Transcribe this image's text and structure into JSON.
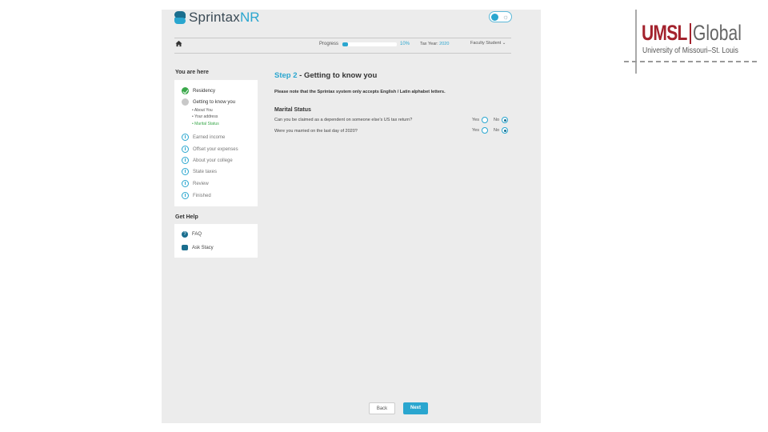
{
  "header": {
    "brand_main": "Sprintax",
    "brand_accent": "NR",
    "progress_label": "Progress",
    "progress_value": 10,
    "progress_text": "10%",
    "tax_year_label": "Tax Year",
    "tax_year_value": "2020",
    "user_name": "Faculty Student"
  },
  "sidebar": {
    "you_are_here": "You are here",
    "steps": [
      {
        "label": "Residency",
        "state": "done"
      },
      {
        "label": "Getting to know you",
        "state": "current"
      },
      {
        "label": "Earned income",
        "state": "todo"
      },
      {
        "label": "Offset your expenses",
        "state": "todo"
      },
      {
        "label": "About your college",
        "state": "todo"
      },
      {
        "label": "State taxes",
        "state": "todo"
      },
      {
        "label": "Review",
        "state": "todo"
      },
      {
        "label": "Finished",
        "state": "todo"
      }
    ],
    "substeps": [
      {
        "label": "About You",
        "active": false
      },
      {
        "label": "Your address",
        "active": false
      },
      {
        "label": "Marital Status",
        "active": true
      }
    ],
    "get_help": "Get Help",
    "help_items": [
      {
        "label": "FAQ",
        "icon": "question-icon"
      },
      {
        "label": "Ask Stacy",
        "icon": "chat-icon"
      }
    ]
  },
  "main": {
    "step_number": "Step 2",
    "step_name": " - Getting to know you",
    "notice": "Please note that the Sprintax system only accepts English / Latin alphabet letters.",
    "section_title": "Marital Status",
    "questions": [
      {
        "text": "Can you be claimed as a dependent on someone else's US tax return?",
        "yes": "Yes",
        "no": "No",
        "selected": "No"
      },
      {
        "text": "Were you married on the last day of 2020?",
        "yes": "Yes",
        "no": "No",
        "selected": "No"
      }
    ],
    "back_label": "Back",
    "next_label": "Next"
  },
  "umsl_logo": {
    "word": "UMSL",
    "global": "Global",
    "subtitle": "University of Missouri–St. Louis"
  },
  "colors": {
    "accent": "#2aa6cf",
    "accent_dark": "#1a6e8e",
    "success": "#3aa84a",
    "umsl_red": "#a3222d"
  }
}
